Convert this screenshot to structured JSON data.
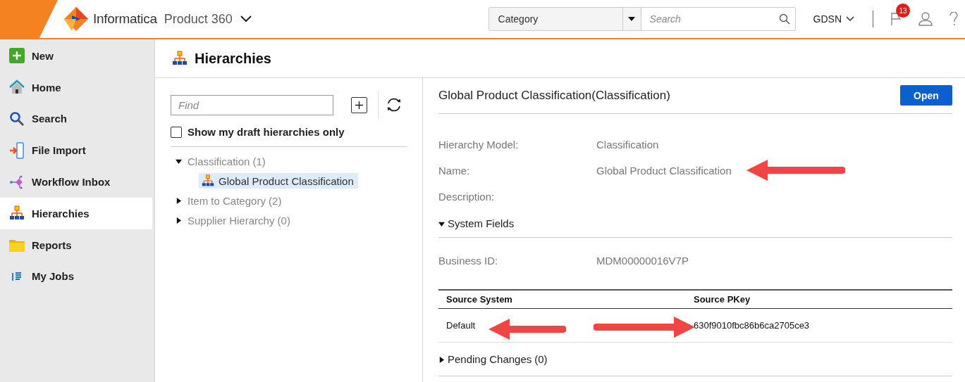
{
  "header": {
    "brand": "Informatica",
    "product": "Product 360",
    "search_scope": "Category",
    "search": {
      "placeholder": "Search"
    },
    "workspace": "GDSN",
    "notification_count": "13"
  },
  "sidebar": {
    "items": [
      {
        "label": "New",
        "selected": false
      },
      {
        "label": "Home",
        "selected": false
      },
      {
        "label": "Search",
        "selected": false
      },
      {
        "label": "File Import",
        "selected": false
      },
      {
        "label": "Workflow Inbox",
        "selected": false
      },
      {
        "label": "Hierarchies",
        "selected": true
      },
      {
        "label": "Reports",
        "selected": false
      },
      {
        "label": "My Jobs",
        "selected": false
      }
    ]
  },
  "page_title": "Hierarchies",
  "tree_panel": {
    "find": {
      "placeholder": "Find"
    },
    "draft_only": {
      "label": "Show my draft hierarchies only",
      "checked": false
    },
    "tree": [
      {
        "label": "Classification (1)",
        "expanded": true,
        "children": [
          {
            "label": "Global Product Classification",
            "selected": true
          }
        ]
      },
      {
        "label": "Item to Category (2)",
        "expanded": false
      },
      {
        "label": "Supplier Hierarchy (0)",
        "expanded": false
      }
    ]
  },
  "details": {
    "title": "Global Product Classification(Classification)",
    "open_button": "Open",
    "fields": [
      {
        "label": "Hierarchy Model:",
        "value": "Classification"
      },
      {
        "label": "Name:",
        "value": "Global Product Classification"
      },
      {
        "label": "Description:"
      }
    ],
    "system_fields": {
      "label": "System Fields",
      "expanded": true,
      "business_id_label": "Business ID:",
      "business_id": "MDM00000016V7P",
      "table": {
        "columns": [
          "Source System",
          "Source PKey"
        ],
        "rows": [
          [
            "Default",
            "630f9010fbc86b6ca2705ce3"
          ]
        ]
      }
    },
    "pending_changes": {
      "label": "Pending Changes",
      "count": "(0)",
      "expanded": false
    }
  }
}
